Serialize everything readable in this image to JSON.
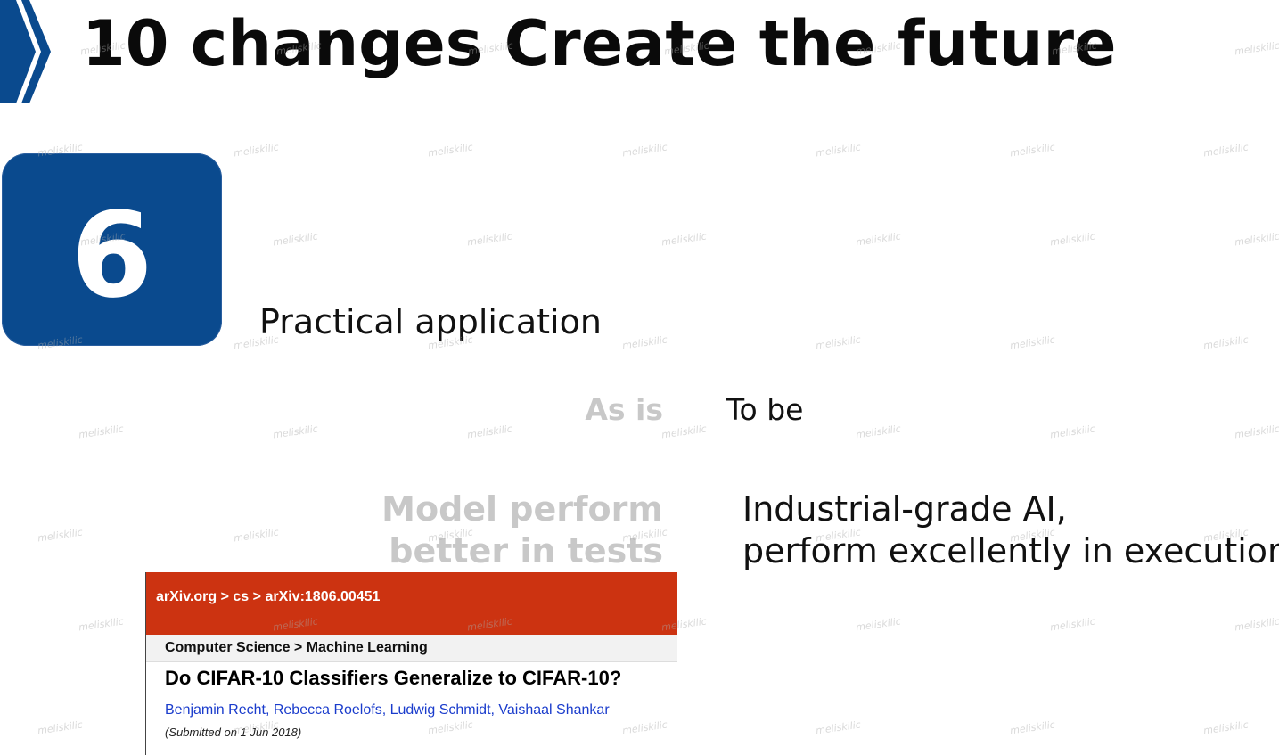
{
  "slide": {
    "title": "10 changes Create the future",
    "number": "6",
    "subtitle": "Practical application",
    "as_is_label": "As is",
    "to_be_label": "To be",
    "as_is_lines": [
      "Model perform",
      "better in tests"
    ],
    "to_be_lines": [
      "Industrial-grade AI,",
      "perform excellently in execution"
    ]
  },
  "arxiv": {
    "breadcrumb": "arXiv.org > cs > arXiv:1806.00451",
    "category": "Computer Science > Machine Learning",
    "title": "Do CIFAR-10 Classifiers Generalize to CIFAR-10?",
    "authors": [
      "Benjamin Recht",
      "Rebecca Roelofs",
      "Ludwig Schmidt",
      "Vaishaal Shankar"
    ],
    "submitted": "(Submitted on 1 Jun 2018)"
  },
  "watermark": "meliskilic",
  "colors": {
    "accent_blue": "#0a4a8e",
    "arxiv_red": "#cc3311",
    "muted_gray": "#c8c8c8"
  },
  "icons": {
    "header_chevron": "chevron-right-icon"
  }
}
